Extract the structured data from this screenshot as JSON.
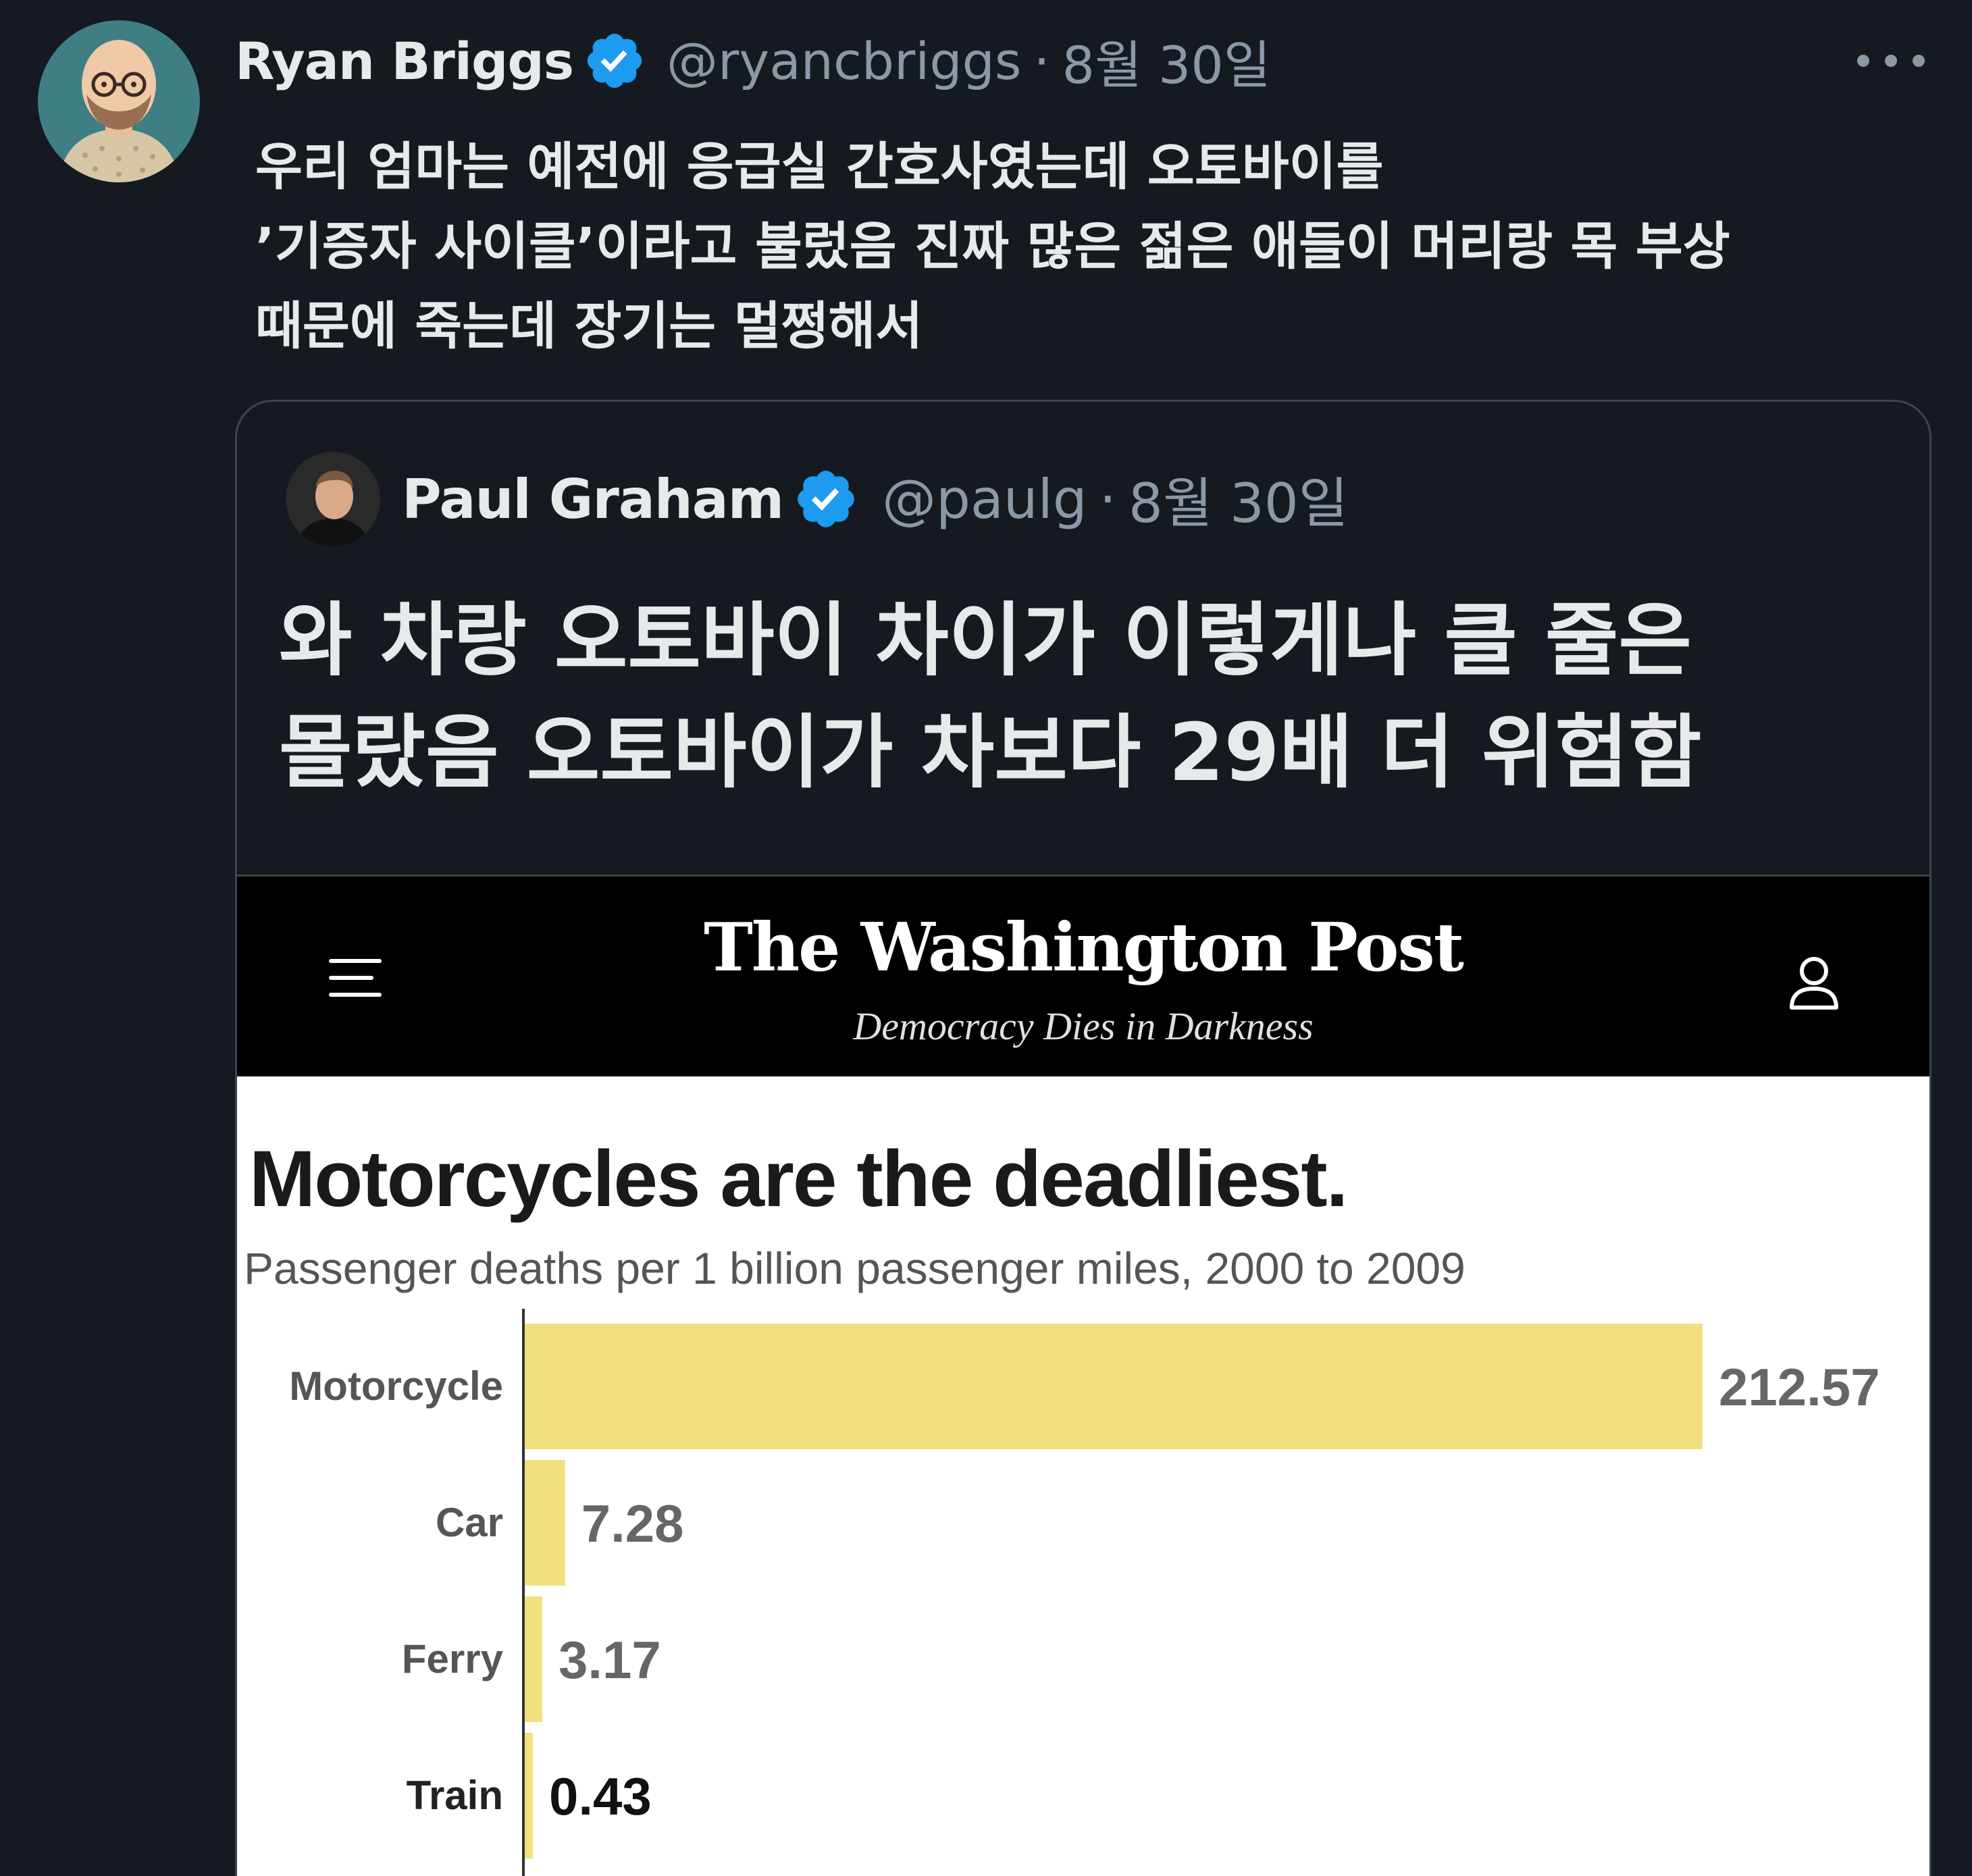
{
  "tweet": {
    "author_name": "Ryan Briggs",
    "handle": "@ryancbriggs",
    "separator": "·",
    "date": "8월 30일",
    "text_lines": [
      "우리 엄마는 예전에 응급실 간호사였는데 오토바이를",
      "’기증자 사이클’이라고 불렀음 진짜 많은 젊은 애들이 머리랑 목 부상",
      "때문에 죽는데 장기는 멀쩡해서"
    ]
  },
  "quote": {
    "author_name": "Paul Graham",
    "handle": "@paulg",
    "separator": "·",
    "date": "8월 30일",
    "text_lines": [
      "와 차랑 오토바이 차이가 이렇게나 클 줄은",
      "몰랐음 오토바이가 차보다 29배 더 위험함"
    ]
  },
  "article": {
    "masthead": "The Washington Post",
    "tagline": "Democracy Dies in Darkness"
  },
  "colors": {
    "background": "#151a21",
    "verified": "#1d9bf0",
    "bar": "#f2e07f"
  },
  "icons": [
    "verified-badge-icon",
    "more-options-icon",
    "hamburger-menu-icon",
    "user-account-icon"
  ],
  "chart_data": {
    "type": "bar",
    "orientation": "horizontal",
    "title": "Motorcycles are the deadliest.",
    "subtitle": "Passenger deaths per 1 billion passenger miles, 2000 to 2009",
    "categories": [
      "Motorcycle",
      "Car",
      "Ferry",
      "Train"
    ],
    "values": [
      212.57,
      7.28,
      3.17,
      0.43
    ],
    "value_labels": [
      "212.57",
      "7.28",
      "3.17",
      "0.43"
    ],
    "xlim": [
      0,
      212.57
    ],
    "grid": false
  }
}
